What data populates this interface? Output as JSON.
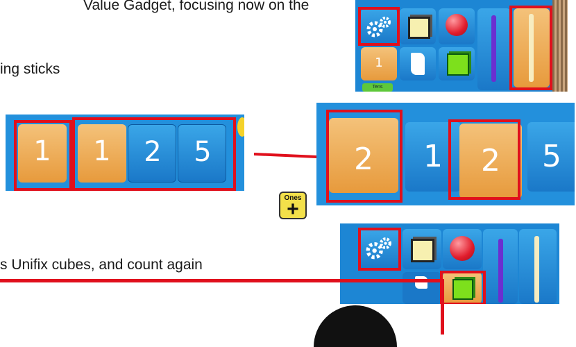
{
  "text": {
    "line1": "Value Gadget, focusing now on the",
    "line2": "ing sticks",
    "line3": "s Unifix cubes, and count again"
  },
  "top_right_panel": {
    "row1": [
      "gears-icon",
      "cube-outline-icon",
      "red-ball-icon",
      "purple-pencil-icon",
      "stick-icon"
    ],
    "row2": {
      "tile_number": "1",
      "tiles": [
        "flat-icon",
        "green-cube-icon"
      ]
    },
    "small_label": "Tens"
  },
  "number_strip_left": {
    "single": "1",
    "group": [
      "1",
      "2",
      "5"
    ]
  },
  "number_strip_right": {
    "left": "2",
    "values": [
      "1",
      "2",
      "5"
    ]
  },
  "ones_button": {
    "label": "Ones",
    "symbol": "+"
  },
  "colors": {
    "highlight": "#e0101c",
    "tile_blue": "#1a78c8",
    "tile_orange": "#e79a3c",
    "ones_yellow": "#f3e04a"
  }
}
